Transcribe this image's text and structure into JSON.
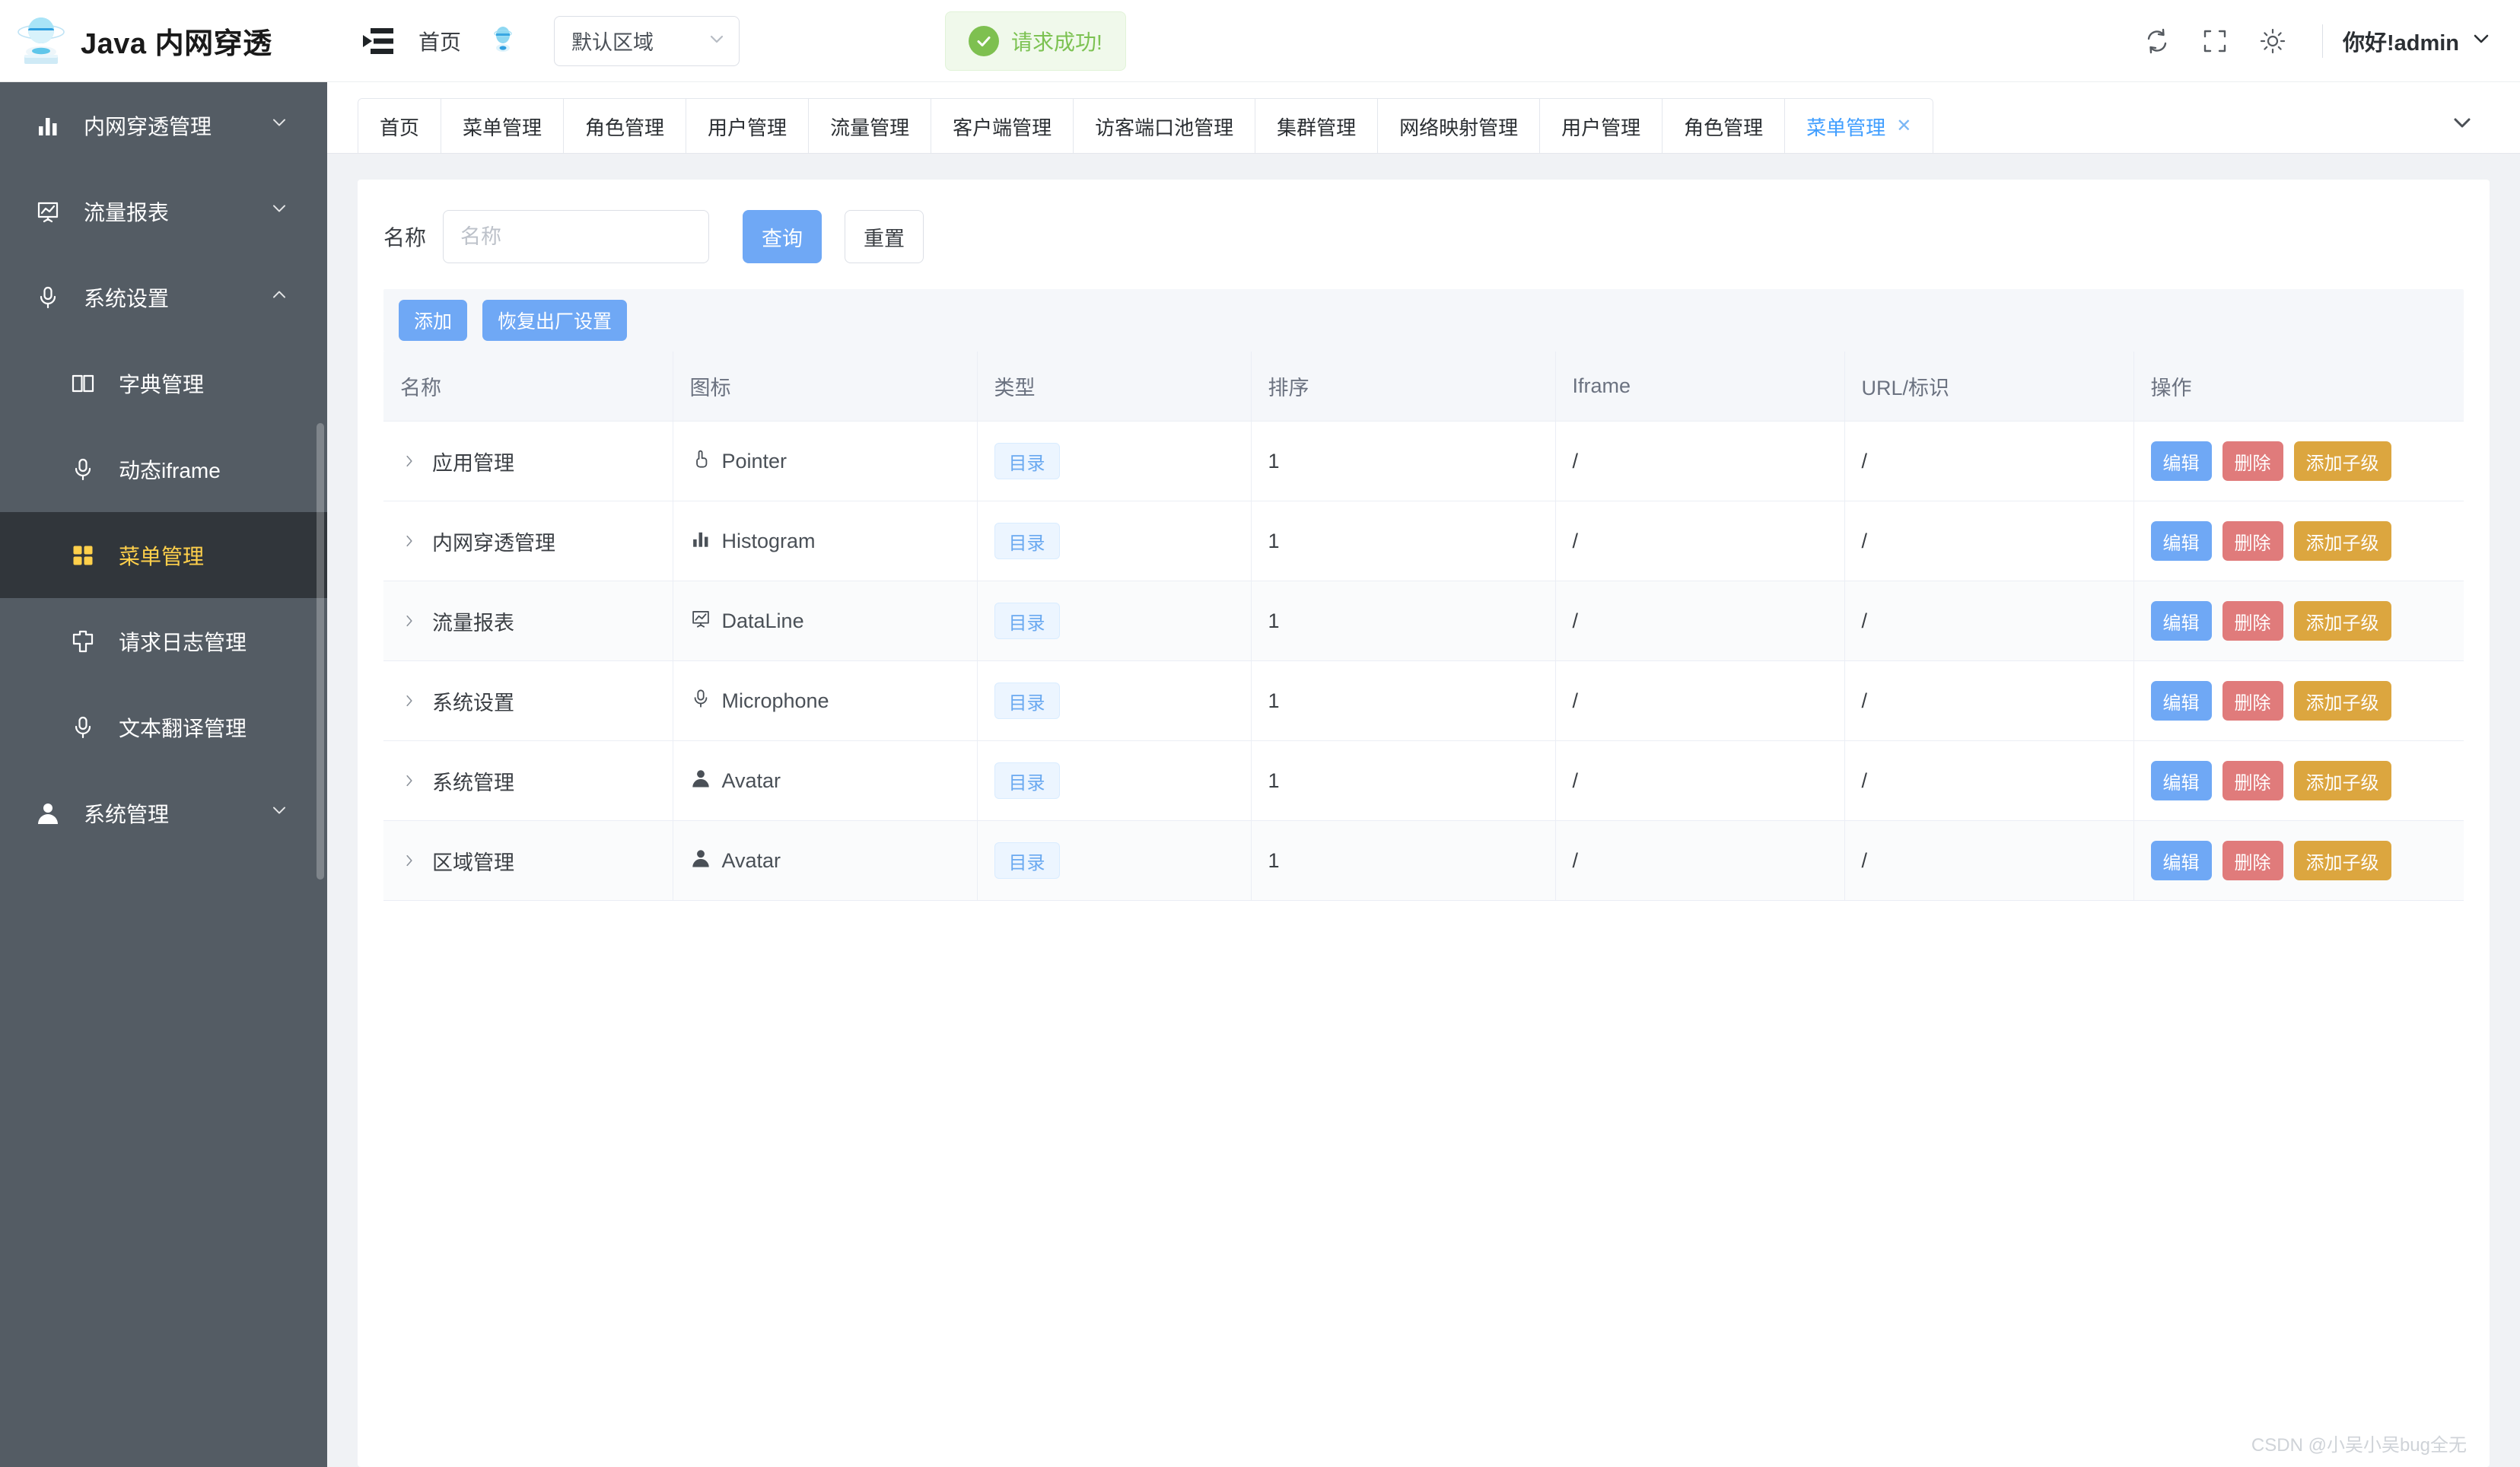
{
  "brand": {
    "title": "Java 内网穿透",
    "logo_icon": "globe-satellite-logo"
  },
  "sidebar": {
    "items": [
      {
        "label": "内网穿透管理",
        "icon": "histogram-icon",
        "arrow": "chevron-down-icon",
        "level": 0,
        "active": false
      },
      {
        "label": "流量报表",
        "icon": "dataline-icon",
        "arrow": "chevron-down-icon",
        "level": 0,
        "active": false
      },
      {
        "label": "系统设置",
        "icon": "microphone-icon",
        "arrow": "chevron-up-icon",
        "level": 0,
        "active": false
      },
      {
        "label": "字典管理",
        "icon": "book-icon",
        "arrow": "",
        "level": 1,
        "active": false
      },
      {
        "label": "动态iframe",
        "icon": "microphone-icon",
        "arrow": "",
        "level": 1,
        "active": false
      },
      {
        "label": "菜单管理",
        "icon": "grid-icon",
        "arrow": "",
        "level": 1,
        "active": true
      },
      {
        "label": "请求日志管理",
        "icon": "log-icon",
        "arrow": "",
        "level": 1,
        "active": false
      },
      {
        "label": "文本翻译管理",
        "icon": "microphone-icon",
        "arrow": "",
        "level": 1,
        "active": false
      },
      {
        "label": "系统管理",
        "icon": "avatar-icon",
        "arrow": "chevron-down-icon",
        "level": 0,
        "active": false
      }
    ]
  },
  "navbar": {
    "hamburger_icon": "collapse-menu-icon",
    "home_label": "首页",
    "ball_icon": "globe-satellite-icon",
    "zone_select": {
      "value": "默认区域",
      "arrow_icon": "chevron-down-icon"
    },
    "alert": {
      "icon": "check-circle-icon",
      "message": "请求成功!",
      "color": "#7cc252",
      "bg": "#f0f9eb"
    },
    "icons": [
      {
        "name": "refresh-icon"
      },
      {
        "name": "fullscreen-icon"
      },
      {
        "name": "theme-sun-icon"
      }
    ],
    "user": {
      "label": "你好!admin",
      "arrow_icon": "chevron-down-icon"
    }
  },
  "tabbar": {
    "tabs": [
      {
        "label": "首页",
        "active": false,
        "closable": false
      },
      {
        "label": "菜单管理",
        "active": false,
        "closable": false
      },
      {
        "label": "角色管理",
        "active": false,
        "closable": false
      },
      {
        "label": "用户管理",
        "active": false,
        "closable": false
      },
      {
        "label": "流量管理",
        "active": false,
        "closable": false
      },
      {
        "label": "客户端管理",
        "active": false,
        "closable": false
      },
      {
        "label": "访客端口池管理",
        "active": false,
        "closable": false
      },
      {
        "label": "集群管理",
        "active": false,
        "closable": false
      },
      {
        "label": "网络映射管理",
        "active": false,
        "closable": false
      },
      {
        "label": "用户管理",
        "active": false,
        "closable": false
      },
      {
        "label": "角色管理",
        "active": false,
        "closable": false
      },
      {
        "label": "菜单管理",
        "active": true,
        "closable": true
      }
    ],
    "more_icon": "chevron-down-icon",
    "close_glyph": "✕"
  },
  "filter": {
    "label": "名称",
    "input_placeholder": "名称",
    "input_value": "",
    "query_label": "查询",
    "reset_label": "重置"
  },
  "toolbar": {
    "add_label": "添加",
    "restore_label": "恢复出厂设置"
  },
  "table": {
    "columns": [
      "名称",
      "图标",
      "类型",
      "排序",
      "Iframe",
      "URL/标识",
      "操作"
    ],
    "rows": [
      {
        "name": "应用管理",
        "icon_name": "Pointer",
        "icon_glyph": "pointer-icon",
        "type": "目录",
        "sort": "1",
        "iframe": "/",
        "url": "/"
      },
      {
        "name": "内网穿透管理",
        "icon_name": "Histogram",
        "icon_glyph": "histogram-icon",
        "type": "目录",
        "sort": "1",
        "iframe": "/",
        "url": "/"
      },
      {
        "name": "流量报表",
        "icon_name": "DataLine",
        "icon_glyph": "dataline-icon",
        "type": "目录",
        "sort": "1",
        "iframe": "/",
        "url": "/"
      },
      {
        "name": "系统设置",
        "icon_name": "Microphone",
        "icon_glyph": "microphone-icon",
        "type": "目录",
        "sort": "1",
        "iframe": "/",
        "url": "/"
      },
      {
        "name": "系统管理",
        "icon_name": "Avatar",
        "icon_glyph": "avatar-icon",
        "type": "目录",
        "sort": "1",
        "iframe": "/",
        "url": "/"
      },
      {
        "name": "区域管理",
        "icon_name": "Avatar",
        "icon_glyph": "avatar-icon",
        "type": "目录",
        "sort": "1",
        "iframe": "/",
        "url": "/"
      }
    ],
    "ops": {
      "edit": "编辑",
      "delete": "删除",
      "add_child": "添加子级"
    },
    "expand_icon": "chevron-right-icon"
  },
  "watermark": "CSDN @小吴小吴bug全无",
  "colors": {
    "sidebar_bg": "#545c64",
    "sidebar_active_bg": "#31363b",
    "accent_yellow": "#ffd04b",
    "primary_blue": "#6fa8f5",
    "link_blue": "#409eff",
    "danger_red": "#e07b7b",
    "warning_orange": "#dca63f",
    "success_green": "#7cc252",
    "page_bg": "#f0f2f5"
  }
}
